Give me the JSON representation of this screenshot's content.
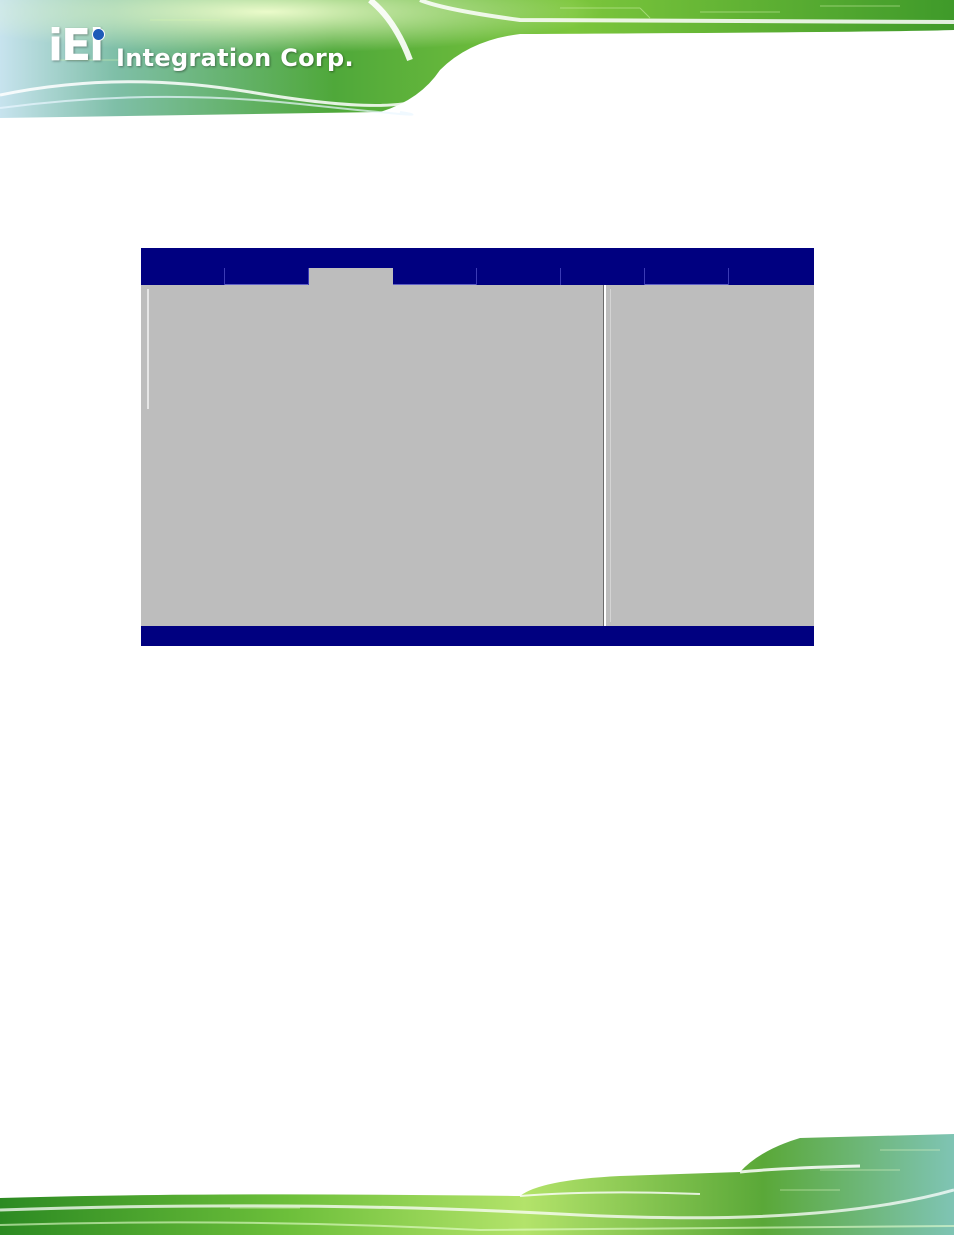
{
  "header": {
    "logo": {
      "brand_mark": "iEi",
      "company_name": "Integration Corp."
    },
    "colors": {
      "banner_dark": "#2e8b1e",
      "banner_light": "#9fd84a",
      "accent_blue": "#1e5bb8"
    }
  },
  "bios": {
    "colors": {
      "frame": "#000080",
      "panel": "#bdbdbd",
      "divider": "#ffffff"
    },
    "title": "",
    "tabs": [
      {
        "label": "",
        "active": false
      },
      {
        "label": "",
        "active": false
      },
      {
        "label": "",
        "active": true
      },
      {
        "label": "",
        "active": false
      },
      {
        "label": "",
        "active": false
      },
      {
        "label": "",
        "active": false
      },
      {
        "label": "",
        "active": false
      },
      {
        "label": "",
        "active": false
      }
    ],
    "main_items": [],
    "help_text": "",
    "footer_text": ""
  },
  "footer": {
    "colors": {
      "banner_dark": "#2e8b1e",
      "banner_light": "#a6dd55"
    }
  }
}
